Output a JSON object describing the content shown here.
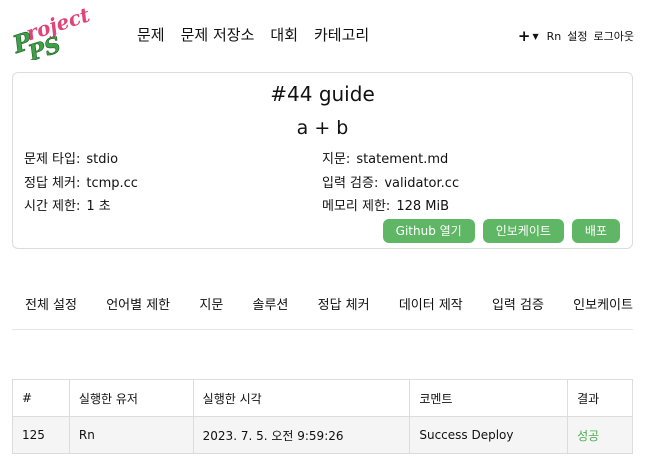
{
  "header": {
    "logo_text": "Project PS",
    "nav": [
      "문제",
      "문제 저장소",
      "대회",
      "카테고리"
    ],
    "user": "Rn",
    "settings_label": "설정",
    "logout_label": "로그아웃"
  },
  "problem": {
    "title": "#44 guide",
    "subtitle": "a + b",
    "info": {
      "type_label": "문제 타입:",
      "type_value": "stdio",
      "statement_label": "지문:",
      "statement_value": "statement.md",
      "checker_label": "정답 체커:",
      "checker_value": "tcmp.cc",
      "validator_label": "입력 검증:",
      "validator_value": "validator.cc",
      "time_label": "시간 제한:",
      "time_value": "1 초",
      "memory_label": "메모리 제한:",
      "memory_value": "128 MiB"
    },
    "buttons": {
      "github": "Github 열기",
      "invoke": "인보케이트",
      "deploy": "배포"
    }
  },
  "tabs": [
    "전체 설정",
    "언어별 제한",
    "지문",
    "솔루션",
    "정답 체커",
    "데이터 제작",
    "입력 검증",
    "인보케이트"
  ],
  "table": {
    "headers": [
      "#",
      "실행한 유저",
      "실행한 시각",
      "코멘트",
      "결과"
    ],
    "rows": [
      [
        "125",
        "Rn",
        "2023. 7. 5. 오전 9:59:26",
        "Success Deploy",
        "성공"
      ]
    ]
  },
  "colors": {
    "accent_green": "#5fb664",
    "success_text": "#4caf50",
    "logo_pink": "#e0457a",
    "logo_green": "#3fa047"
  }
}
